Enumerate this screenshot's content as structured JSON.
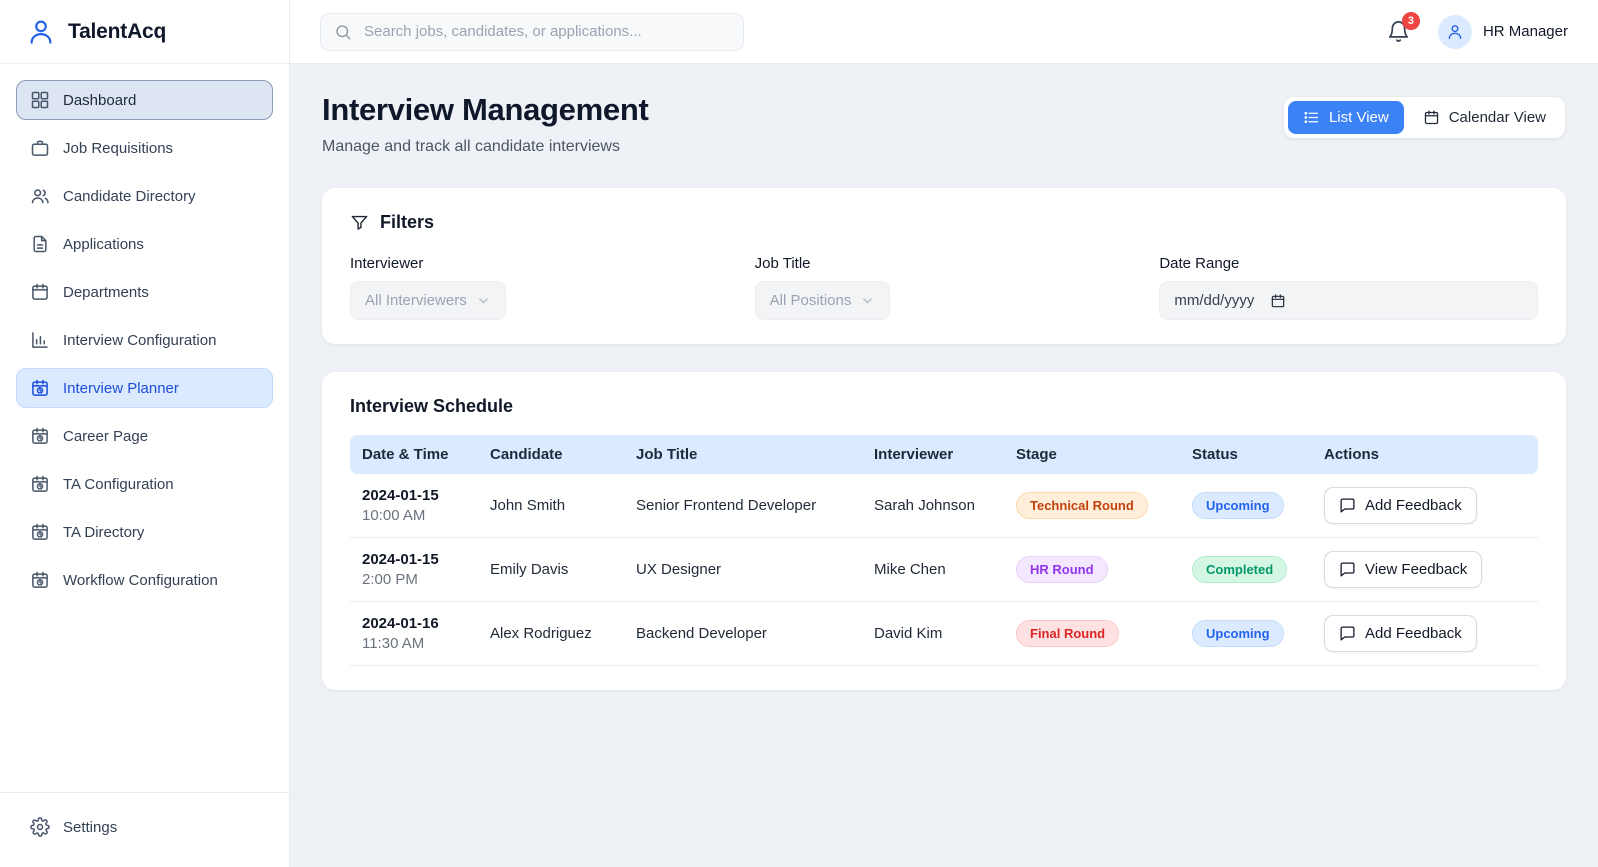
{
  "app": {
    "name": "TalentAcq"
  },
  "topbar": {
    "search_placeholder": "Search jobs, candidates, or applications...",
    "notification_count": "3",
    "user_name": "HR Manager"
  },
  "sidebar": {
    "items": [
      {
        "label": "Dashboard",
        "icon": "grid",
        "focused": true
      },
      {
        "label": "Job Requisitions",
        "icon": "briefcase"
      },
      {
        "label": "Candidate Directory",
        "icon": "users"
      },
      {
        "label": "Applications",
        "icon": "document"
      },
      {
        "label": "Departments",
        "icon": "calendar"
      },
      {
        "label": "Interview Configuration",
        "icon": "bar-chart"
      },
      {
        "label": "Interview Planner",
        "icon": "calendar-clock",
        "active": true
      },
      {
        "label": "Career Page",
        "icon": "calendar-clock"
      },
      {
        "label": "TA Configuration",
        "icon": "calendar-clock"
      },
      {
        "label": "TA Directory",
        "icon": "calendar-clock"
      },
      {
        "label": "Workflow Configuration",
        "icon": "calendar-clock"
      }
    ],
    "settings_label": "Settings"
  },
  "page": {
    "title": "Interview Management",
    "subtitle": "Manage and track all candidate interviews",
    "view_toggle": {
      "list_label": "List View",
      "calendar_label": "Calendar View",
      "active": "List View"
    }
  },
  "filters": {
    "title": "Filters",
    "interviewer": {
      "label": "Interviewer",
      "value": "All Interviewers"
    },
    "job_title": {
      "label": "Job Title",
      "value": "All Positions"
    },
    "date_range": {
      "label": "Date Range",
      "value": "mm/dd/yyyy"
    }
  },
  "schedule": {
    "title": "Interview Schedule",
    "columns": [
      "Date & Time",
      "Candidate",
      "Job Title",
      "Interviewer",
      "Stage",
      "Status",
      "Actions"
    ],
    "rows": [
      {
        "date": "2024-01-15",
        "time": "10:00 AM",
        "candidate": "John Smith",
        "job_title": "Senior Frontend Developer",
        "interviewer": "Sarah Johnson",
        "stage": "Technical Round",
        "stage_tone": "orange",
        "status": "Upcoming",
        "status_tone": "blue",
        "action": "Add Feedback"
      },
      {
        "date": "2024-01-15",
        "time": "2:00 PM",
        "candidate": "Emily Davis",
        "job_title": "UX Designer",
        "interviewer": "Mike Chen",
        "stage": "HR Round",
        "stage_tone": "purple",
        "status": "Completed",
        "status_tone": "green",
        "action": "View Feedback"
      },
      {
        "date": "2024-01-16",
        "time": "11:30 AM",
        "candidate": "Alex Rodriguez",
        "job_title": "Backend Developer",
        "interviewer": "David Kim",
        "stage": "Final Round",
        "stage_tone": "red",
        "status": "Upcoming",
        "status_tone": "blue",
        "action": "Add Feedback"
      }
    ]
  },
  "colors": {
    "accent": "#3b82f6",
    "notification_badge": "#ef4444",
    "table_header_bg": "#dbeafe",
    "badge_orange_bg": "#ffeeda",
    "badge_orange_text": "#c2410c",
    "badge_purple_bg": "#f3e8ff",
    "badge_purple_text": "#9333ea",
    "badge_red_bg": "#fee2e2",
    "badge_red_text": "#dc2626",
    "badge_blue_bg": "#dbeafe",
    "badge_blue_text": "#2563eb",
    "badge_green_bg": "#d4f7e4",
    "badge_green_text": "#059669"
  }
}
